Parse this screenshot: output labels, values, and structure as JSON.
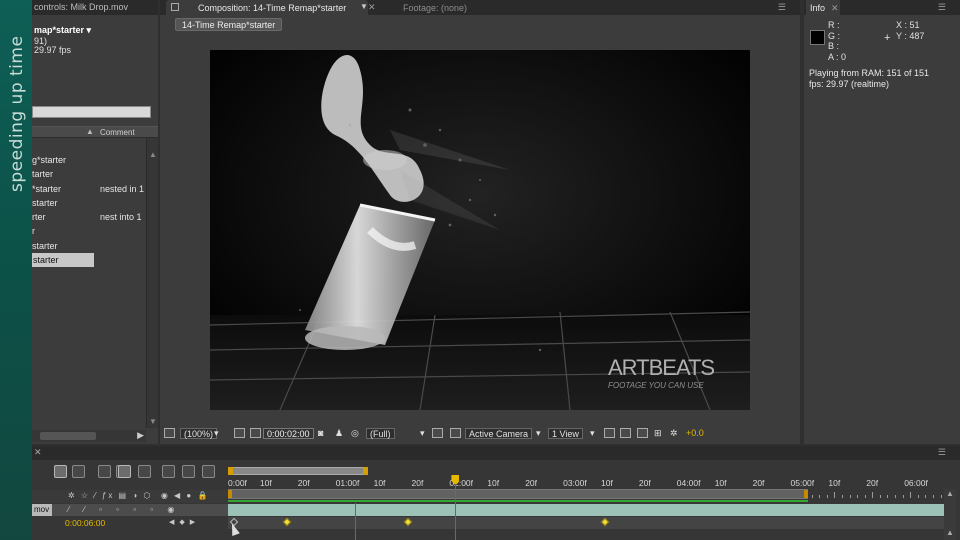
{
  "banner": {
    "text": "speeding up time"
  },
  "project": {
    "tab_label": "controls: Milk Drop.mov",
    "title": "map*starter ▾",
    "sub1": "91)",
    "sub2": "29.97 fps",
    "header_comment": "Comment",
    "rows": [
      {
        "name": "g*starter",
        "comment": ""
      },
      {
        "name": "tarter",
        "comment": ""
      },
      {
        "name": "*starter",
        "comment": "nested in 1"
      },
      {
        "name": "starter",
        "comment": ""
      },
      {
        "name": "rter",
        "comment": "nest into 1"
      },
      {
        "name": "r",
        "comment": ""
      },
      {
        "name": "starter",
        "comment": ""
      },
      {
        "name": "starter",
        "comment": "",
        "selected": true
      }
    ]
  },
  "composition": {
    "tab_label": "Composition: 14-Time Remap*starter",
    "footage_tab": "Footage: (none)",
    "breadcrumb": "14-Time Remap*starter",
    "watermark_brand": "ARTBEATS",
    "watermark_tagline": "FOOTAGE YOU CAN USE",
    "toolbar": {
      "zoom": "(100%)",
      "timecode": "0:00:02:00",
      "resolution": "(Full)",
      "camera": "Active Camera",
      "views": "1 View",
      "exposure": "+0.0"
    }
  },
  "info": {
    "tab_label": "Info",
    "r": "R :",
    "g": "G :",
    "b": "B :",
    "a": "A : 0",
    "x": "X : 51",
    "y": "Y : 487",
    "line1": "Playing from RAM: 151 of 151",
    "line2": "fps: 29.97 (realtime)"
  },
  "timeline": {
    "layer_name": "mov",
    "remap_value": "0:00:06:00",
    "ruler": [
      {
        "label": "0:00f",
        "pos": 0
      },
      {
        "label": "10f",
        "pos": 10
      },
      {
        "label": "20f",
        "pos": 20
      },
      {
        "label": "01:00f",
        "pos": 30
      },
      {
        "label": "10f",
        "pos": 40
      },
      {
        "label": "20f",
        "pos": 50
      },
      {
        "label": "02:00f",
        "pos": 60
      },
      {
        "label": "10f",
        "pos": 70
      },
      {
        "label": "20f",
        "pos": 80
      },
      {
        "label": "03:00f",
        "pos": 90
      },
      {
        "label": "10f",
        "pos": 100
      },
      {
        "label": "20f",
        "pos": 110
      },
      {
        "label": "04:00f",
        "pos": 120
      },
      {
        "label": "10f",
        "pos": 130
      },
      {
        "label": "20f",
        "pos": 140
      },
      {
        "label": "05:00f",
        "pos": 150
      },
      {
        "label": "10f",
        "pos": 160
      },
      {
        "label": "20f",
        "pos": 170
      },
      {
        "label": "06:00f",
        "pos": 180
      }
    ],
    "playhead_frame": 60,
    "keyframes": [
      0,
      14,
      46,
      98
    ]
  },
  "colors": {
    "accent": "#e6b800",
    "banner": "#0e5f56",
    "layer_bar": "#9cc1b6",
    "playhead": "#d23c3c"
  }
}
